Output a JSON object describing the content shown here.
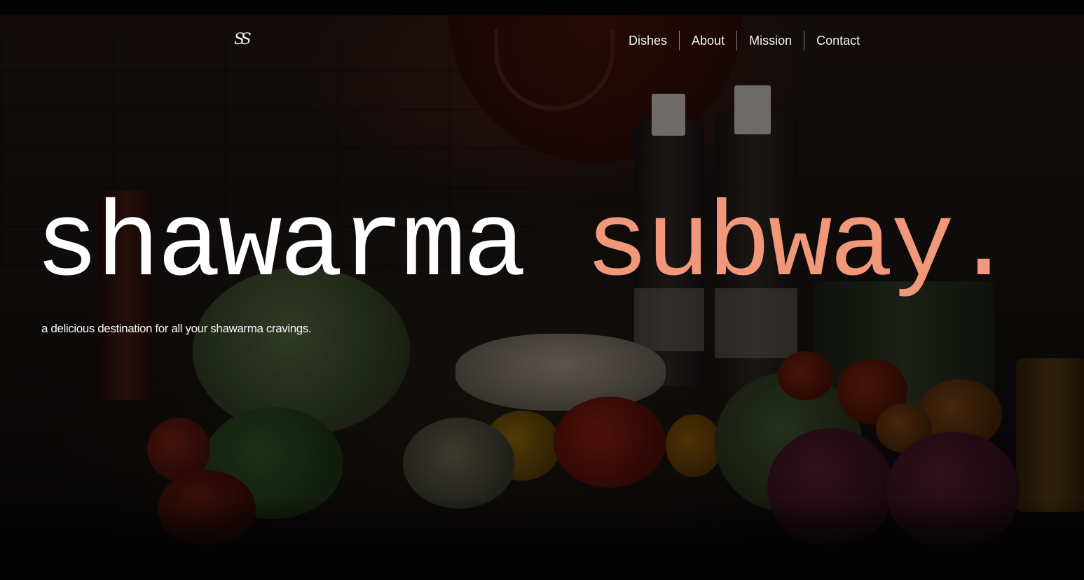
{
  "brand": {
    "logo_text": "SS"
  },
  "nav": {
    "items": [
      {
        "label": "Dishes"
      },
      {
        "label": "About"
      },
      {
        "label": "Mission"
      },
      {
        "label": "Contact"
      }
    ]
  },
  "hero": {
    "headline_part1": "shawarma",
    "headline_part2": "subway.",
    "tagline": "a delicious destination for all your shawarma cravings.",
    "accent_color": "#f2987a"
  }
}
